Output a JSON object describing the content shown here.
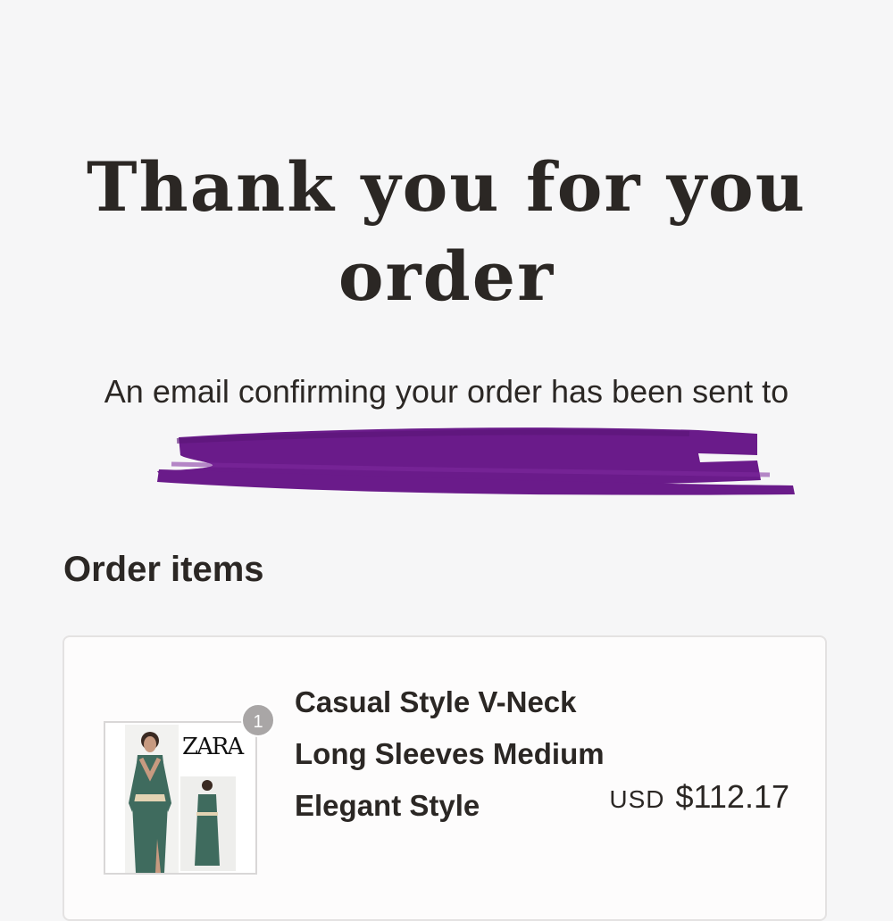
{
  "confirmation": {
    "headline": "Thank you for you order",
    "email_notice": "An email confirming your order has been sent to"
  },
  "order_items": {
    "title": "Order items",
    "items": [
      {
        "quantity": "1",
        "brand_logo": "ZARA",
        "name": "Casual Style V-Neck Long Sleeves Medium Elegant Style",
        "currency": "USD",
        "price": "$112.17"
      }
    ]
  },
  "colors": {
    "background": "#f6f6f7",
    "text": "#2b2724",
    "redaction": "#6a1b8a",
    "badge": "#a9a6a6"
  }
}
